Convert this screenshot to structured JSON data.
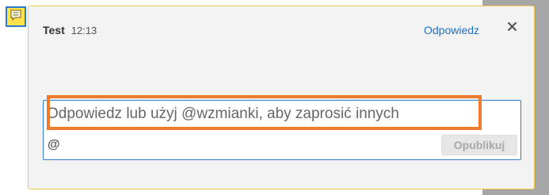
{
  "colors": {
    "accent": "#2b7bd1",
    "link": "#1e6fc4",
    "highlight": "#ee7a2d",
    "card_border": "#f2c94c",
    "marker": "#ffe24a"
  },
  "marker": {
    "icon": "comment-icon"
  },
  "comment": {
    "author": "Test",
    "time": "12:13",
    "reply_label": "Odpowiedz",
    "close_icon": "close-icon"
  },
  "reply": {
    "placeholder": "Odpowiedz lub użyj @wzmianki, aby zaprosić innych",
    "value": "",
    "mention_label": "@",
    "publish_label": "Opublikuj"
  }
}
